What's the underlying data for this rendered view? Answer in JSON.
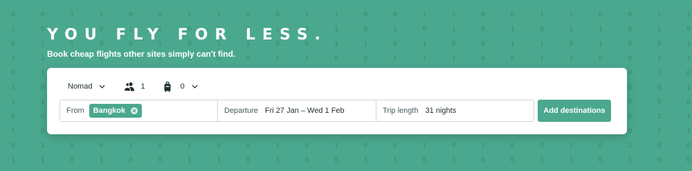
{
  "hero": {
    "title": "YOU FLY FOR LESS.",
    "subtitle": "Book cheap flights other sites simply can't find."
  },
  "options": {
    "mode_label": "Nomad",
    "passengers": "1",
    "bags": "0"
  },
  "search": {
    "from_label": "From",
    "from_value": "Bangkok",
    "departure_label": "Departure",
    "departure_value": "Fri 27 Jan – Wed 1 Feb",
    "trip_label": "Trip length",
    "trip_value": "31 nights",
    "add_button": "Add destinations"
  },
  "colors": {
    "brand": "#4aa88e",
    "text": "#1f2d33",
    "white": "#ffffff"
  },
  "icons": {
    "mode_chevron": "chevron-down-icon",
    "passengers": "passengers-icon",
    "bags": "luggage-icon",
    "bags_chevron": "chevron-down-icon",
    "chip_remove": "close-circle-icon"
  }
}
